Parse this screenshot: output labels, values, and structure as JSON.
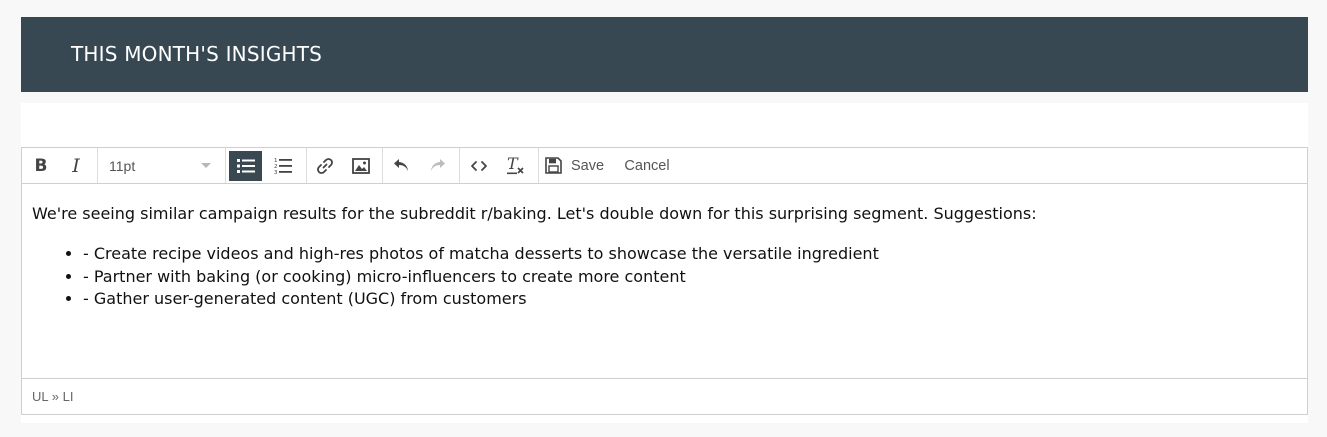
{
  "header": {
    "title": "THIS MONTH'S INSIGHTS"
  },
  "toolbar": {
    "bold_label": "B",
    "italic_label": "I",
    "font_size": "11pt",
    "save_label": "Save",
    "cancel_label": "Cancel",
    "icons": [
      "bold-icon",
      "italic-icon",
      "bullet-list-icon",
      "numbered-list-icon",
      "link-icon",
      "image-icon",
      "undo-icon",
      "redo-icon",
      "code-icon",
      "clear-formatting-icon",
      "save-icon"
    ]
  },
  "content": {
    "paragraph": "We're seeing similar campaign results for the subreddit r/baking. Let's double down for this surprising segment. Suggestions:",
    "list_items": [
      "- Create recipe videos and high-res photos of matcha desserts to showcase the versatile ingredient",
      "- Partner with baking (or cooking) micro-influencers to create more content",
      "- Gather user-generated content (UGC) from customers"
    ]
  },
  "statusbar": {
    "path": "UL » LI"
  },
  "colors": {
    "header_bg": "#374853",
    "active_button_bg": "#3a4852"
  }
}
